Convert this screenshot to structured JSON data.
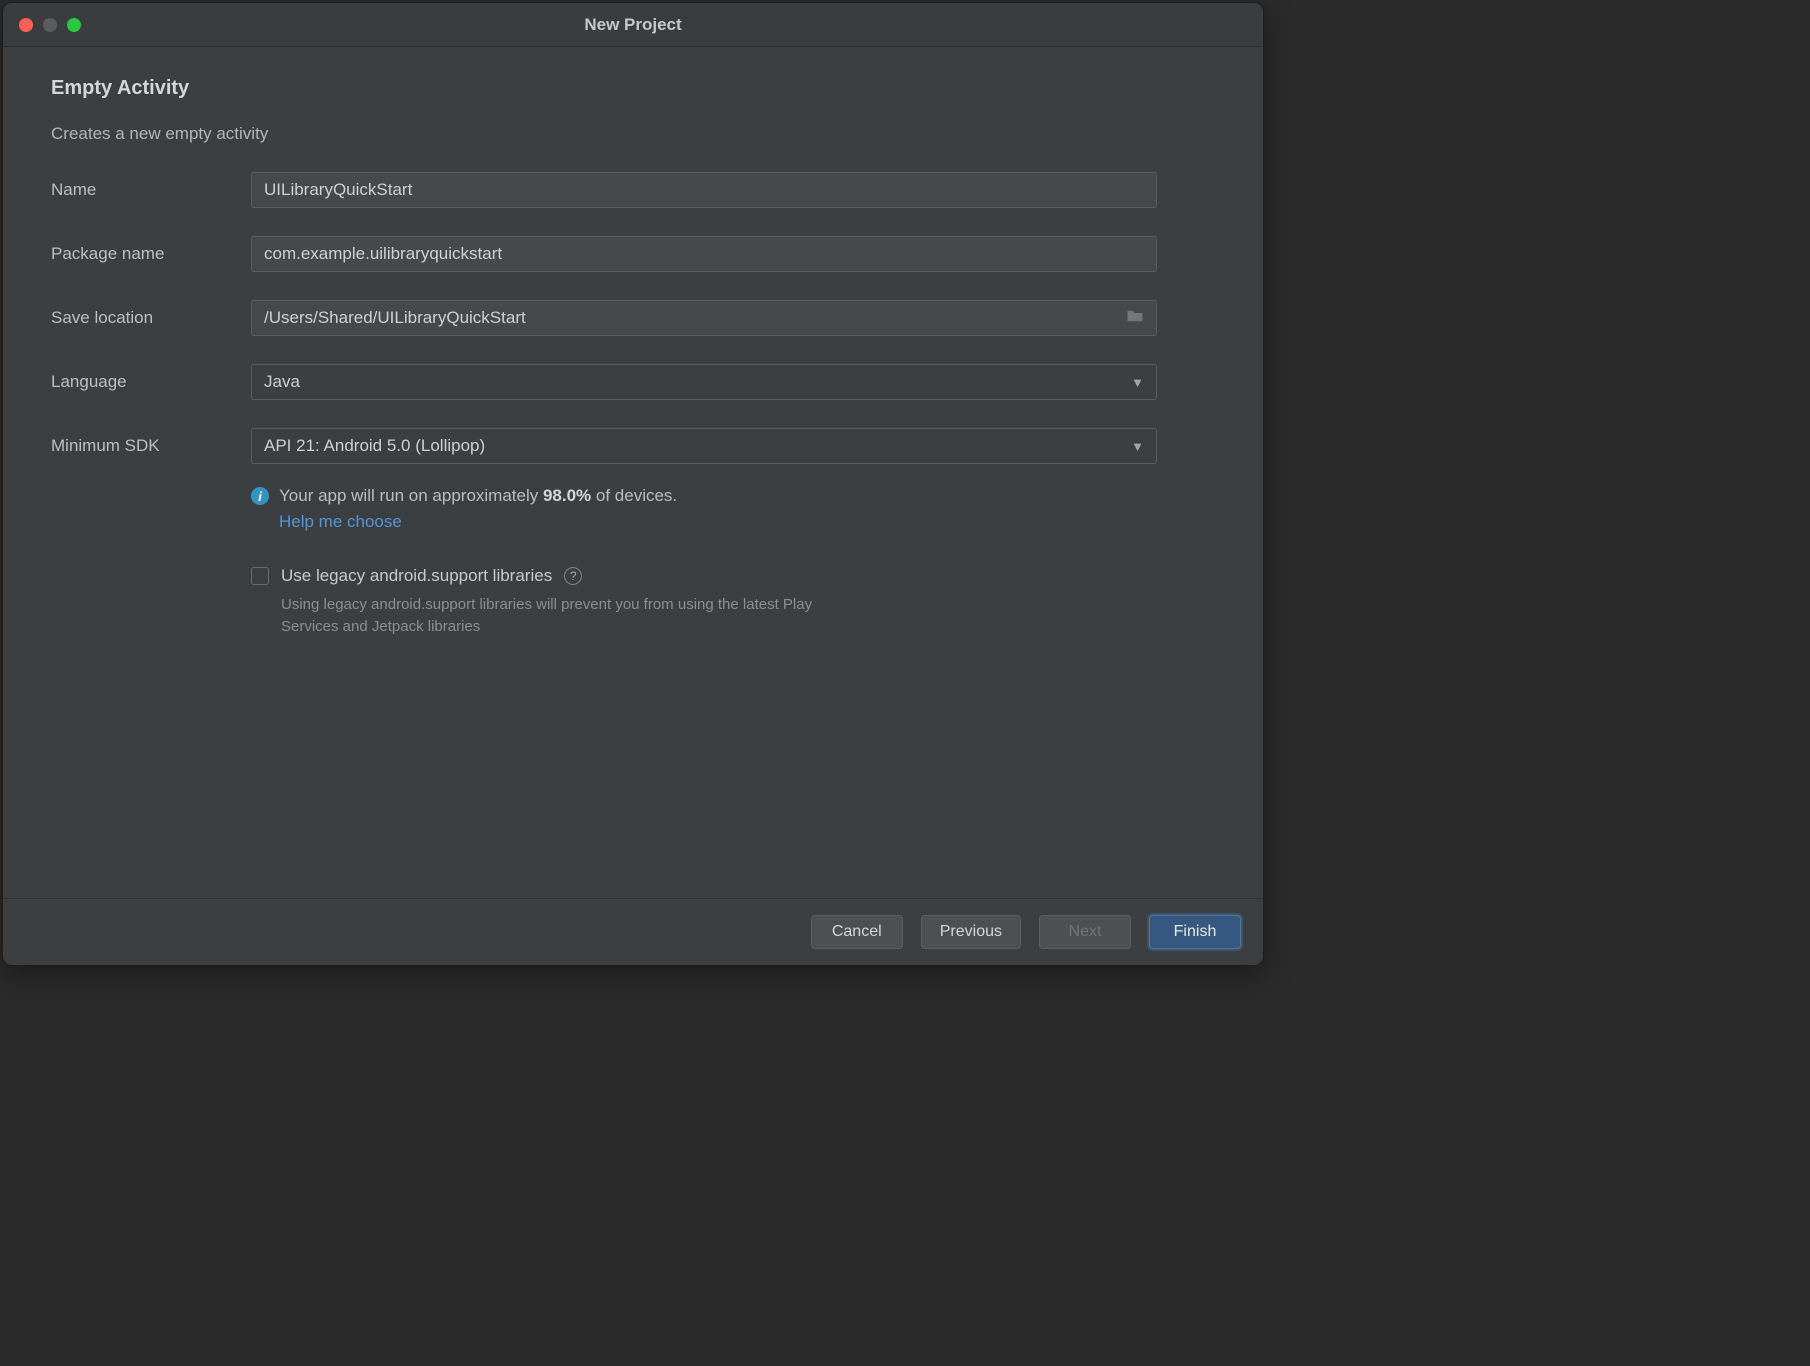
{
  "window": {
    "title": "New Project"
  },
  "page": {
    "heading": "Empty Activity",
    "subtitle": "Creates a new empty activity"
  },
  "form": {
    "name": {
      "label": "Name",
      "value": "UILibraryQuickStart"
    },
    "package": {
      "label": "Package name",
      "value": "com.example.uilibraryquickstart"
    },
    "location": {
      "label": "Save location",
      "value": "/Users/Shared/UILibraryQuickStart"
    },
    "language": {
      "label": "Language",
      "value": "Java"
    },
    "minsdk": {
      "label": "Minimum SDK",
      "value": "API 21: Android 5.0 (Lollipop)"
    }
  },
  "info": {
    "pre": "Your app will run on approximately ",
    "pct": "98.0%",
    "post": " of devices.",
    "help": "Help me choose"
  },
  "legacy": {
    "label": "Use legacy android.support libraries",
    "desc": "Using legacy android.support libraries will prevent you from using the latest Play Services and Jetpack libraries"
  },
  "buttons": {
    "cancel": "Cancel",
    "previous": "Previous",
    "next": "Next",
    "finish": "Finish"
  }
}
